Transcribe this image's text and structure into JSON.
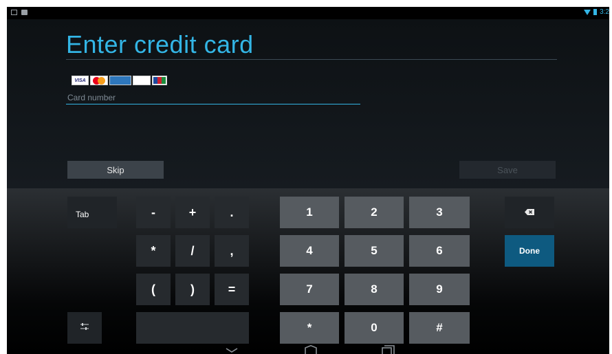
{
  "status_bar": {
    "left_icons": [
      "image-icon",
      "camera-icon"
    ],
    "right_icons": [
      "wifi-icon",
      "battery-icon"
    ],
    "time": "3:2"
  },
  "page": {
    "title": "Enter credit card"
  },
  "card_logos": [
    "VISA",
    "MasterCard",
    "American Express",
    "DISCOVER",
    "JCB"
  ],
  "card_field": {
    "value": "",
    "placeholder": "Card number"
  },
  "buttons": {
    "skip": "Skip",
    "save": "Save"
  },
  "keyboard": {
    "tab": "Tab",
    "minus": "-",
    "plus": "+",
    "period": ".",
    "asterisk": "*",
    "slash": "/",
    "comma": ",",
    "lparen": "(",
    "rparen": ")",
    "equals": "=",
    "numbers": [
      "1",
      "2",
      "3",
      "4",
      "5",
      "6",
      "7",
      "8",
      "9"
    ],
    "star": "*",
    "zero": "0",
    "pound": "#",
    "done": "Done",
    "backspace_icon": "backspace-icon",
    "settings_icon": "settings-icon"
  },
  "nav_bar": {
    "icons": [
      "back-icon",
      "home-icon",
      "recent-apps-icon"
    ]
  },
  "colors": {
    "accent": "#33b5e5",
    "done": "#0e5a80",
    "background": "#0a0d10"
  }
}
